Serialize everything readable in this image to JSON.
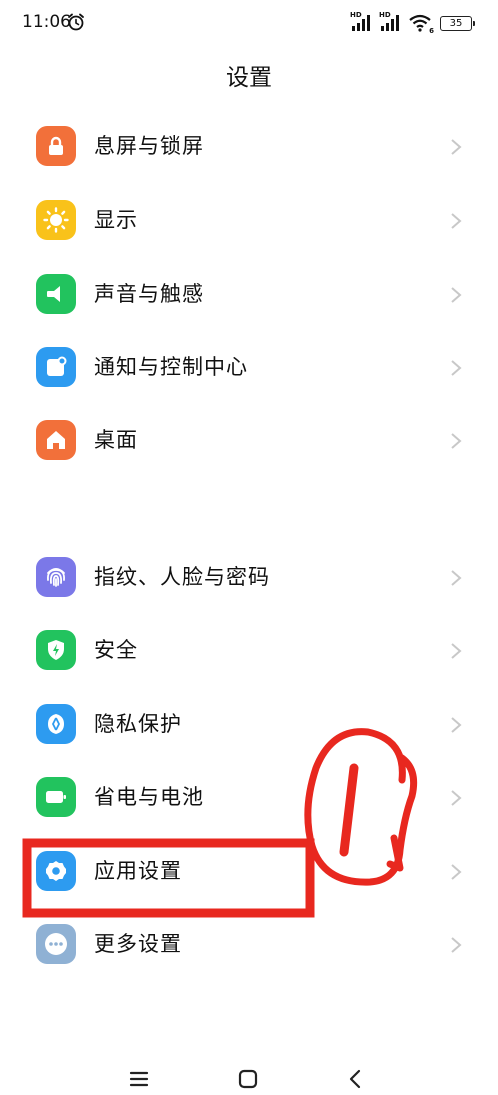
{
  "status": {
    "time": "11:06",
    "signal_tag_1": "HD",
    "signal_tag_2": "HD",
    "wifi_tag": "6",
    "battery": "35"
  },
  "header": {
    "title": "设置"
  },
  "group1": [
    {
      "label": "息屏与锁屏",
      "icon": "lock-icon",
      "color": "#F2703A"
    },
    {
      "label": "显示",
      "icon": "sun-icon",
      "color": "#F9C21A"
    },
    {
      "label": "声音与触感",
      "icon": "speaker-icon",
      "color": "#22C35E"
    },
    {
      "label": "通知与控制中心",
      "icon": "notification-icon",
      "color": "#2D9BF0"
    },
    {
      "label": "桌面",
      "icon": "home-icon",
      "color": "#F2703A"
    }
  ],
  "group2": [
    {
      "label": "指纹、人脸与密码",
      "icon": "fingerprint-icon",
      "color": "#7B78E8"
    },
    {
      "label": "安全",
      "icon": "shield-icon",
      "color": "#22C35E"
    },
    {
      "label": "隐私保护",
      "icon": "privacy-icon",
      "color": "#2D9BF0"
    },
    {
      "label": "省电与电池",
      "icon": "battery-icon",
      "color": "#22C35E"
    },
    {
      "label": "应用设置",
      "icon": "gear-icon",
      "color": "#2D9BF0"
    },
    {
      "label": "更多设置",
      "icon": "more-icon",
      "color": "#8FB1D4"
    }
  ],
  "annotation": {
    "color": "#E8281F"
  }
}
